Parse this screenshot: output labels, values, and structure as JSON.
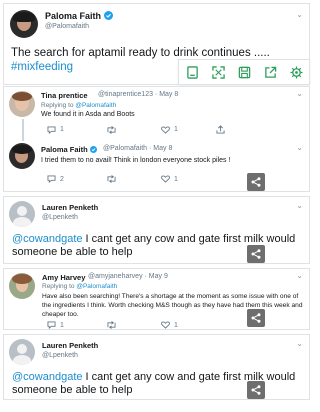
{
  "main_tweet": {
    "name": "Paloma Faith",
    "handle": "@Palomafaith",
    "text": "The search for aptamil ready to drink continues .....",
    "hashtag": "#mixfeeding"
  },
  "reply1": {
    "name": "Tina prentice",
    "handle_meta": "@tinaprentice123 · May 8",
    "replying_prefix": "Replying to",
    "replying_to": "@Palomafaith",
    "text": "We found it in Asda and Boots",
    "reply_count": "1",
    "retweet_count": "",
    "like_count": "1"
  },
  "reply2": {
    "name": "Paloma Faith",
    "handle_meta": "@Palomafaith · May 8",
    "text": "I tried them to no avail! Think in london everyone stock piles !",
    "reply_count": "2",
    "retweet_count": "",
    "like_count": "1"
  },
  "tweet3": {
    "name": "Lauren Penketh",
    "handle": "@Lpenketh",
    "mention": "@cowandgate",
    "text": " I cant get any cow and gate first milk would someone be able to help"
  },
  "tweet4": {
    "name": "Amy Harvey",
    "handle_meta": "@amyjaneharvey · May 9",
    "replying_prefix": "Replying to",
    "replying_to": "@Palomafaith",
    "text": "Have also been searching! There's a shortage at the moment as some issue with one of the ingredients I think. Worth checking M&S though as they have had them this week and cheaper too.",
    "reply_count": "1",
    "retweet_count": "",
    "like_count": "1"
  },
  "tweet5": {
    "name": "Lauren Penketh",
    "handle": "@Lpenketh",
    "mention": "@cowandgate",
    "text": " I cant get any cow and gate first milk would someone be able to help"
  },
  "toolbar": {
    "icons": [
      "edit-icon",
      "expand-icon",
      "save-icon",
      "share-out-icon",
      "settings-icon"
    ]
  },
  "colors": {
    "link": "#1d8ecd",
    "verified": "#1da1f2",
    "toolbar_icon": "#2e9e5b",
    "share_chip": "#6e6e6e",
    "muted": "#657786"
  }
}
